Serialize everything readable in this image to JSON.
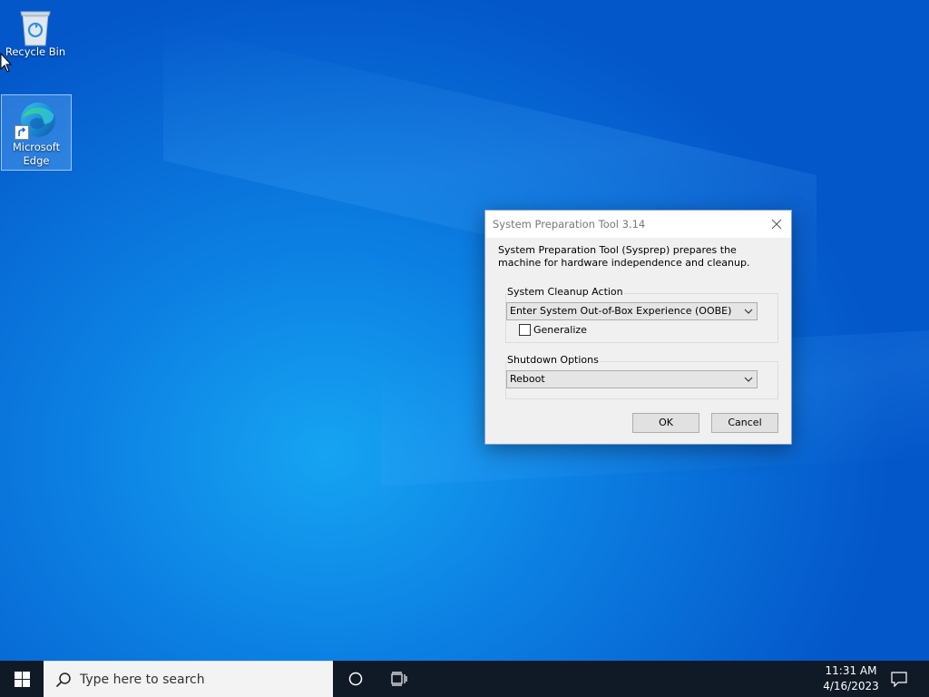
{
  "desktop": {
    "icons": [
      {
        "label": "Recycle Bin",
        "icon": "recycle-bin-icon"
      },
      {
        "label": "Microsoft\nEdge",
        "icon": "edge-icon"
      }
    ]
  },
  "dialog": {
    "title": "System Preparation Tool 3.14",
    "description": "System Preparation Tool (Sysprep) prepares the machine for hardware independence and cleanup.",
    "cleanup_group_label": "System Cleanup Action",
    "cleanup_action_value": "Enter System Out-of-Box Experience (OOBE)",
    "generalize_label": "Generalize",
    "generalize_checked": false,
    "shutdown_group_label": "Shutdown Options",
    "shutdown_value": "Reboot",
    "ok_label": "OK",
    "cancel_label": "Cancel"
  },
  "taskbar": {
    "search_placeholder": "Type here to search",
    "time": "11:31 AM",
    "date": "4/16/2023"
  },
  "colors": {
    "desktop_blue": "#0a78de",
    "taskbar": "#101a26",
    "dialog_bg": "#f0f0f0"
  }
}
